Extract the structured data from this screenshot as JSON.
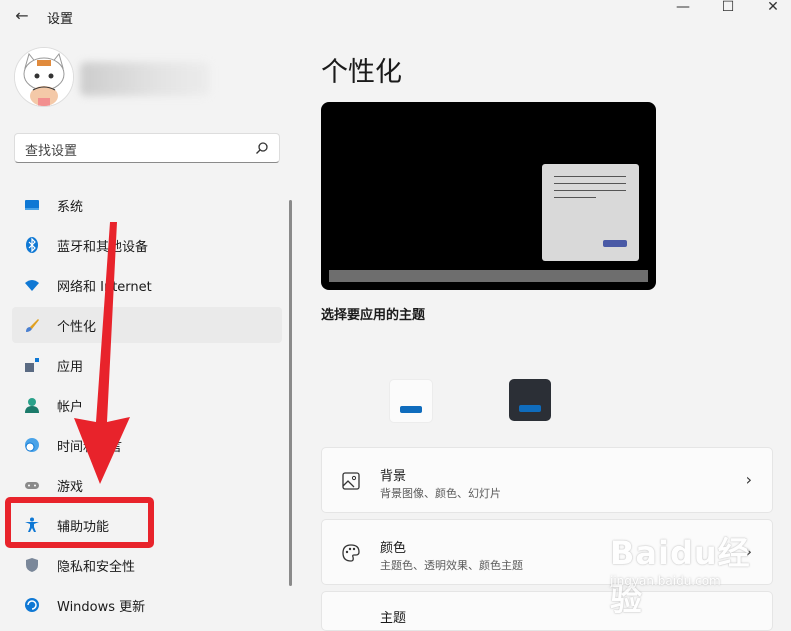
{
  "window": {
    "title": "设置",
    "controls": [
      "minimize-icon",
      "maximize-icon",
      "close-icon"
    ]
  },
  "search": {
    "placeholder": "查找设置"
  },
  "sidebar": {
    "items": [
      {
        "label": "系统",
        "icon": "display-icon"
      },
      {
        "label": "蓝牙和其他设备",
        "icon": "bluetooth-icon"
      },
      {
        "label": "网络和 Internet",
        "icon": "wifi-icon"
      },
      {
        "label": "个性化",
        "icon": "brush-icon",
        "selected": true
      },
      {
        "label": "应用",
        "icon": "apps-icon"
      },
      {
        "label": "帐户",
        "icon": "person-icon"
      },
      {
        "label": "时间和语言",
        "icon": "globe-clock-icon"
      },
      {
        "label": "游戏",
        "icon": "gamepad-icon"
      },
      {
        "label": "辅助功能",
        "icon": "accessibility-icon"
      },
      {
        "label": "隐私和安全性",
        "icon": "shield-icon"
      },
      {
        "label": "Windows 更新",
        "icon": "update-icon"
      }
    ]
  },
  "main": {
    "title": "个性化",
    "theme_label": "选择要应用的主题",
    "cards": [
      {
        "title": "背景",
        "subtitle": "背景图像、颜色、幻灯片",
        "icon": "image-icon"
      },
      {
        "title": "颜色",
        "subtitle": "主题色、透明效果、颜色主题",
        "icon": "palette-icon"
      },
      {
        "title": "主题",
        "icon": "theme-icon"
      }
    ]
  },
  "colors": {
    "accent": "#005fb8",
    "annotation": "#e8232b"
  },
  "watermark": {
    "text": "Baidu经验",
    "url": "jingyan.baidu.com"
  }
}
